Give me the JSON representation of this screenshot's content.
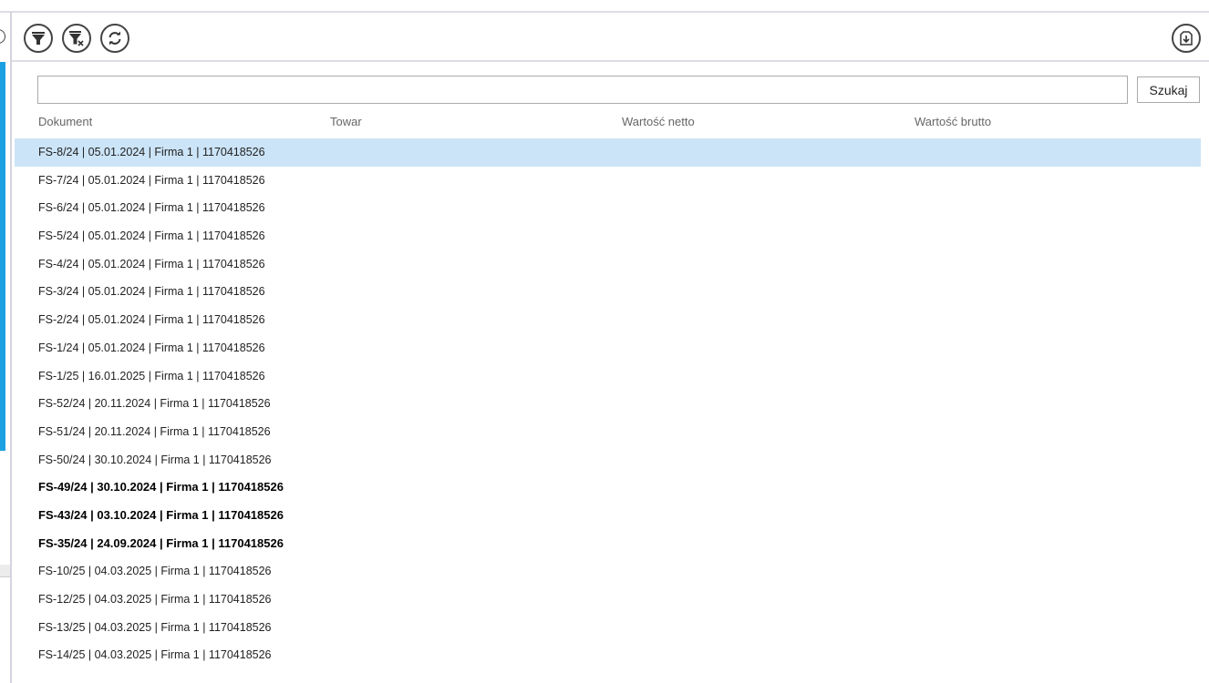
{
  "toolbar": {
    "icons": [
      "filter-icon",
      "clear-filter-icon",
      "refresh-icon",
      "export-icon"
    ]
  },
  "search": {
    "value": "",
    "button": "Szukaj"
  },
  "columns": [
    "Dokument",
    "Towar",
    "Wartość netto",
    "Wartość brutto"
  ],
  "rows": [
    {
      "text": "FS-8/24 | 05.01.2024 | Firma 1 | 1170418526",
      "selected": true,
      "bold": false
    },
    {
      "text": "FS-7/24 | 05.01.2024 | Firma 1 | 1170418526",
      "bold": false
    },
    {
      "text": "FS-6/24 | 05.01.2024 | Firma 1 | 1170418526",
      "bold": false
    },
    {
      "text": "FS-5/24 | 05.01.2024 | Firma 1 | 1170418526",
      "bold": false
    },
    {
      "text": "FS-4/24 | 05.01.2024 | Firma 1 | 1170418526",
      "bold": false
    },
    {
      "text": "FS-3/24 | 05.01.2024 | Firma 1 | 1170418526",
      "bold": false
    },
    {
      "text": "FS-2/24 | 05.01.2024 | Firma 1 | 1170418526",
      "bold": false
    },
    {
      "text": "FS-1/24 | 05.01.2024 | Firma 1 | 1170418526",
      "bold": false
    },
    {
      "text": "FS-1/25 | 16.01.2025 | Firma 1 | 1170418526",
      "bold": false
    },
    {
      "text": "FS-52/24 | 20.11.2024 | Firma 1 | 1170418526",
      "bold": false
    },
    {
      "text": "FS-51/24 | 20.11.2024 | Firma 1 | 1170418526",
      "bold": false
    },
    {
      "text": "FS-50/24 | 30.10.2024 | Firma 1 | 1170418526",
      "bold": false
    },
    {
      "text": "FS-49/24 | 30.10.2024 | Firma 1 | 1170418526",
      "bold": true
    },
    {
      "text": "FS-43/24 | 03.10.2024 | Firma 1 | 1170418526",
      "bold": true
    },
    {
      "text": "FS-35/24 | 24.09.2024 | Firma 1 | 1170418526",
      "bold": true
    },
    {
      "text": "FS-10/25 | 04.03.2025 | Firma 1 | 1170418526",
      "bold": false
    },
    {
      "text": "FS-12/25 | 04.03.2025 | Firma 1 | 1170418526",
      "bold": false
    },
    {
      "text": "FS-13/25 | 04.03.2025 | Firma 1 | 1170418526",
      "bold": false
    },
    {
      "text": "FS-14/25 | 04.03.2025 | Firma 1 | 1170418526",
      "bold": false
    }
  ],
  "colors": {
    "selected": "#cce4f7",
    "accent": "#1ba1e2"
  }
}
